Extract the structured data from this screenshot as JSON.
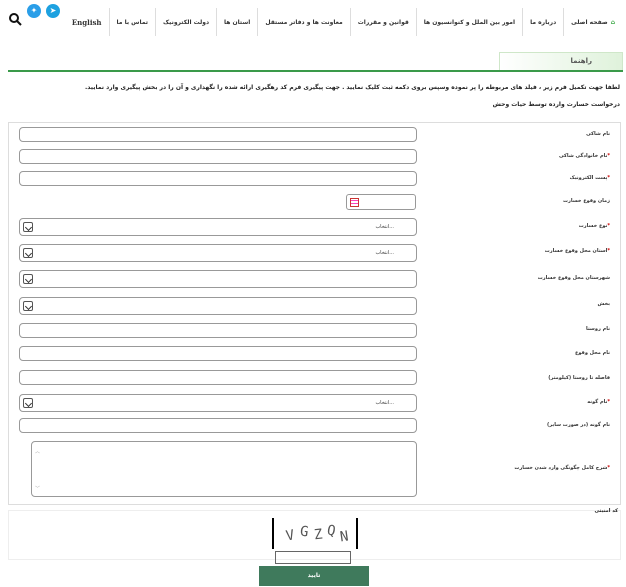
{
  "nav": {
    "home": "صفحه اصلی",
    "about": "درباره ما",
    "intl": "امور بین الملل و کنوانسیون ها",
    "laws": "قوانین و مقررات",
    "deputies": "معاونت ها و دفاتر مستقل",
    "provinces": "استان ها",
    "egov": "دولت الکترونیک",
    "contact": "تماس با ما",
    "english": "English"
  },
  "social": {
    "telegram_icon": "telegram-icon",
    "twitter_icon": "twitter-icon"
  },
  "guide": {
    "title": "راهنما"
  },
  "instructions": {
    "line1": "لطفا جهت تکمیل فرم زیر ، فیلد های مربوطه را پر نموده وسپس بروی دکمه ثبت کلیک نمایید . جهت پیگیری فرم کد رهگیری ارائه شده را نگهداری و آن را در بخش پیگیری وارد نمایید.",
    "line2": "درخواست خسارت وارده توسط حیات وحش"
  },
  "form": {
    "name": "نام شاکی",
    "family": "نام خانوادگی شاکی",
    "email": "پست الکترونیک",
    "date": "زمان وقوع خسارت",
    "damage_type": "نوع خسارت",
    "province": "استان محل وقوع خسارت",
    "city": "شهرستان محل وقوع خسارت",
    "district": "بخش",
    "village": "نام روستا",
    "place": "نام محل وقوع",
    "distance": "فاصله تا روستا (کیلومتر)",
    "species": "نام گونه",
    "species_other": "نام گونه (در صورت سایر)",
    "description": "شرح کامل چگونگی وارد شدن خسارت",
    "select_placeholder": "انتخاب..."
  },
  "captcha": {
    "label": "کد امنیتی",
    "text": "VGZQN"
  },
  "submit": {
    "label": "تایید"
  }
}
